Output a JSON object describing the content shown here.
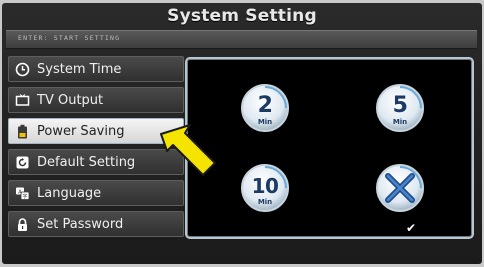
{
  "header": {
    "title": "System Setting",
    "hint": "ENTER: START SETTING"
  },
  "menu": {
    "items": [
      {
        "label": "System Time",
        "icon": "clock-icon",
        "active": false
      },
      {
        "label": "TV Output",
        "icon": "tv-icon",
        "active": false
      },
      {
        "label": "Power Saving",
        "icon": "battery-icon",
        "active": true
      },
      {
        "label": "Default Setting",
        "icon": "reset-icon",
        "active": false
      },
      {
        "label": "Language",
        "icon": "language-icon",
        "active": false
      },
      {
        "label": "Set Password",
        "icon": "lock-icon",
        "active": false
      }
    ]
  },
  "power_saving": {
    "options": [
      {
        "value": "2",
        "unit": "Min"
      },
      {
        "value": "5",
        "unit": "Min"
      },
      {
        "value": "10",
        "unit": "Min"
      },
      {
        "value": "",
        "unit": "",
        "icon": "off-x-icon",
        "selected": true
      }
    ],
    "selected_mark": "✔"
  },
  "colors": {
    "accent_arrow": "#f5e400",
    "badge": "#eaf3fb",
    "badge_text": "#1d3a63",
    "panel_border": "#b9c6d0"
  }
}
